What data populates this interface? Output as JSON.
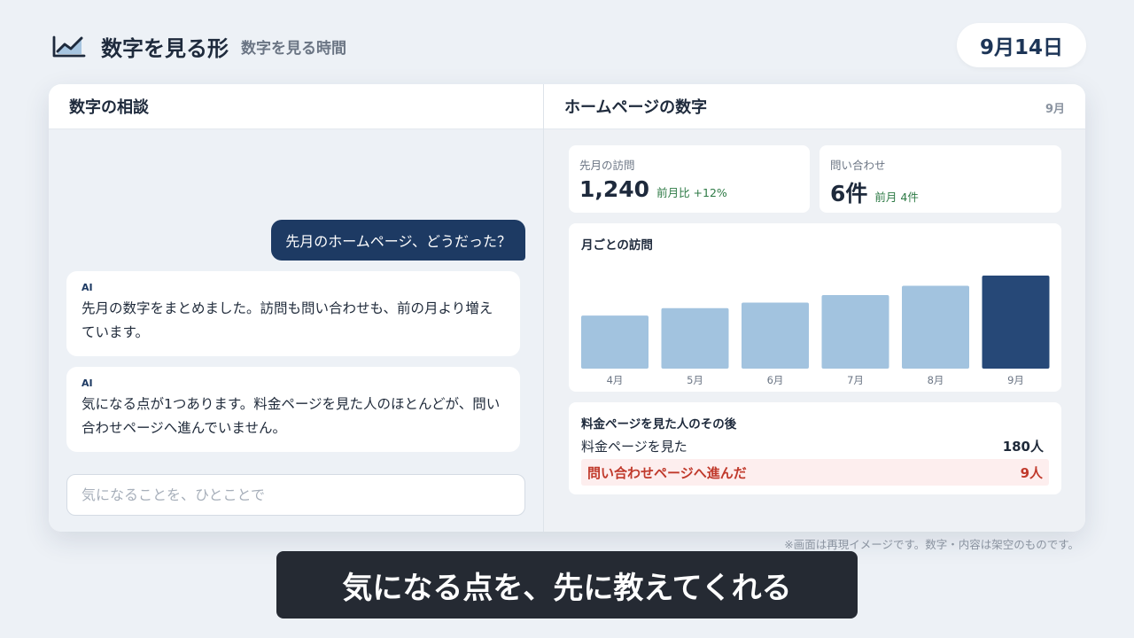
{
  "header": {
    "logo_icon": "line-chart-icon",
    "title": "数字を見る形",
    "subtitle": "数字を見る時間",
    "date": "9月14日"
  },
  "chat": {
    "title": "数字の相談",
    "user_message": "先月のホームページ、どうだった？",
    "ai_messages": [
      {
        "tag": "AI",
        "text": "先月の数字をまとめました。訪問も問い合わせも、前の月より増えています。"
      },
      {
        "tag": "AI",
        "text": "気になる点が1つあります。料金ページを見た人のほとんどが、問い合わせページへ進んでいません。"
      }
    ],
    "input_placeholder": "気になることを、ひとことで"
  },
  "site": {
    "title": "ホームページの数字",
    "month": "9月",
    "stats": [
      {
        "label": "先月の訪問",
        "value": "1,240",
        "delta": "前月比 +12%"
      },
      {
        "label": "問い合わせ",
        "value": "6件",
        "delta": "前月 4件"
      }
    ],
    "funnel": {
      "title": "料金ページを見た人のその後",
      "rows": [
        {
          "label": "料金ページを見た",
          "value": "180人"
        },
        {
          "label": "問い合わせページへ進んだ",
          "value": "9人"
        }
      ]
    }
  },
  "chart_data": {
    "type": "bar",
    "title": "月ごとの訪問",
    "categories": [
      "4月",
      "5月",
      "6月",
      "7月",
      "8月",
      "9月"
    ],
    "values": [
      0.57,
      0.65,
      0.71,
      0.79,
      0.89,
      1.0
    ],
    "value_scale": "relative (no printed axis; 9月 bar = 1.0)",
    "colors": {
      "normal": "#a2c3df",
      "highlight": "#264877"
    },
    "highlight_index": 5,
    "grid": false,
    "legend": "none"
  },
  "colors": {
    "accent": "#1d3a63",
    "positive": "#2d7a45",
    "alert": "#c0392b",
    "alert_bg": "#fdeeee"
  },
  "footer": {
    "disclaimer": "※画面は再現イメージです。数字・内容は架空のものです。",
    "caption": "気になる点を、先に教えてくれる"
  }
}
